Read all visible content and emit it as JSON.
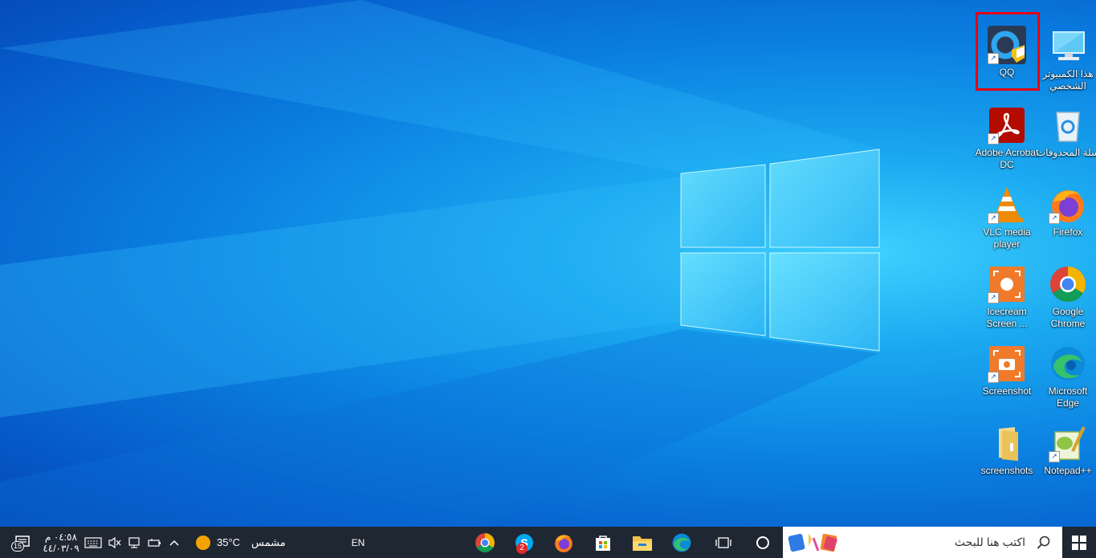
{
  "desktop_icons": [
    {
      "label": "QQ"
    },
    {
      "label": "هذا الكمبيوتر الشخصي"
    },
    {
      "label": "Adobe Acrobat DC"
    },
    {
      "label": "سلة المحذوفات"
    },
    {
      "label": "VLC media player"
    },
    {
      "label": "Firefox"
    },
    {
      "label": "Icecream Screen ..."
    },
    {
      "label": "Google Chrome"
    },
    {
      "label": "Screenshot"
    },
    {
      "label": "Microsoft Edge"
    },
    {
      "label": "screenshots"
    },
    {
      "label": "Notepad++"
    }
  ],
  "taskbar": {
    "search_placeholder": "اكتب هنا للبحث",
    "language": "EN",
    "weather_temp": "35°C",
    "weather_desc": "مشمس",
    "clock_time": "٠٤:٥٨ م",
    "clock_date": "٤٤/٠٣/٠٩",
    "skype_badge": "2",
    "notification_count": "15"
  },
  "colors": {
    "taskbar_bg": "#1f2733",
    "highlight": "#e60012"
  }
}
